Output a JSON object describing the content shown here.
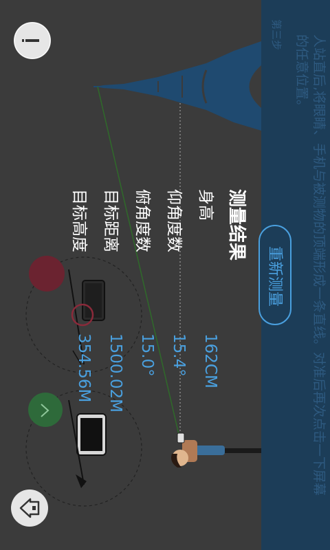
{
  "results": {
    "title": "测量结果",
    "rows": [
      {
        "label": "身高",
        "value": "162CM"
      },
      {
        "label": "仰角度数",
        "value": "15.4°"
      },
      {
        "label": "俯角度数",
        "value": "15.0°"
      },
      {
        "label": "目标距离",
        "value": "1500.02M"
      },
      {
        "label": "目标高度",
        "value": "354.56M"
      }
    ]
  },
  "remeasure_label": "重新测量",
  "instruction": {
    "step": "第三步",
    "text": "人站直后,将眼睛、手机与被测物的顶端形成一条直线。对准后再次点击一下屏幕的任意位置。"
  },
  "icons": {
    "info": "info-icon",
    "home": "home-icon",
    "check": "check-icon",
    "target": "target-icon"
  },
  "colors": {
    "background": "#3b3b3b",
    "panel": "#1c3d58",
    "accent": "#4aa0df",
    "check_green": "#2e6a3a",
    "target_red": "#6b2330"
  }
}
